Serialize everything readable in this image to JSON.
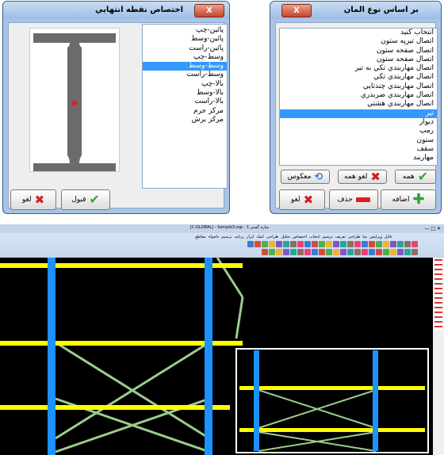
{
  "dialog_right": {
    "title": "بر اساس نوع المان",
    "close_label": "X",
    "list_header": "انتخاب کنيد",
    "items": [
      "اتصال تيرپه ستون",
      "اتصال صفحه ستون",
      "اتصال صفحه ستون",
      "اتصال مهاربندي تکي به تير",
      "اتصال مهاربندي تکي",
      "اتصال مهاربندي چندتايي",
      "اتصال مهاربندي ضربدري",
      "اتصال مهاربندي هشتي",
      "تير",
      "ديوار",
      "رمپ",
      "ستون",
      "سقف",
      "مهاربند"
    ],
    "selected_index": 8,
    "buttons": {
      "all": "همه",
      "cancel_all": "لغو همه",
      "invert": "معکوس",
      "add": "اضافه",
      "delete": "حذف",
      "cancel": "لغو"
    }
  },
  "dialog_left": {
    "title": "اختصاص نقطه انتهايي",
    "close_label": "X",
    "items": [
      "پائين-چپ",
      "پائين-وسط",
      "پائين-راست",
      "وسط-چپ",
      "وسط-وسط",
      "وسط-راست",
      "بالا-چپ",
      "بالا-وسط",
      "بالا-راست",
      "مرکز جرم",
      "مرکز برش"
    ],
    "selected_index": 4,
    "buttons": {
      "ok": "قبول",
      "cancel": "لغو"
    }
  },
  "app": {
    "title_text": "[C:GLOBAL] - Sample3.ssp - سازه گستر 1",
    "tabs": [
      "فایل",
      "ویرایش",
      "نما",
      "طراحی",
      "تعریف",
      "ترسیم",
      "انتخاب",
      "اختصاص",
      "تحلیل",
      "طراحی",
      "کمک",
      "ابزار",
      "برنامه",
      "ترسیم",
      "دلخواه",
      "مقاطع"
    ]
  },
  "colors": {
    "beam": "#ffff00",
    "column": "#1e90ff",
    "brace": "#9acd8a",
    "selected": "#3399ff"
  }
}
